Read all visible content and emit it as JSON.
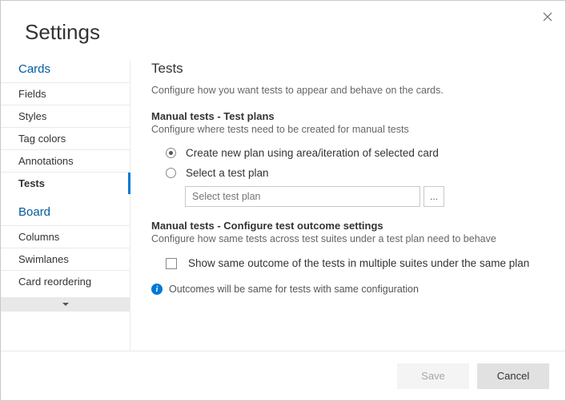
{
  "header": {
    "title": "Settings"
  },
  "sidebar": {
    "sections": [
      {
        "heading": "Cards",
        "items": [
          {
            "label": "Fields",
            "selected": false
          },
          {
            "label": "Styles",
            "selected": false
          },
          {
            "label": "Tag colors",
            "selected": false
          },
          {
            "label": "Annotations",
            "selected": false
          },
          {
            "label": "Tests",
            "selected": true
          }
        ]
      },
      {
        "heading": "Board",
        "items": [
          {
            "label": "Columns",
            "selected": false
          },
          {
            "label": "Swimlanes",
            "selected": false
          },
          {
            "label": "Card reordering",
            "selected": false
          }
        ]
      }
    ]
  },
  "content": {
    "title": "Tests",
    "subtitle": "Configure how you want tests to appear and behave on the cards.",
    "group1": {
      "title": "Manual tests - Test plans",
      "sub": "Configure where tests need to be created for manual tests",
      "optionA": "Create new plan using area/iteration of selected card",
      "optionB": "Select a test plan",
      "plan_placeholder": "Select test plan",
      "browse_label": "..."
    },
    "group2": {
      "title": "Manual tests - Configure test outcome settings",
      "sub": "Configure how same tests across test suites under a test plan need to behave",
      "checkbox_label": "Show same outcome of the tests in multiple suites under the same plan"
    },
    "info": "Outcomes will be same for tests with same configuration"
  },
  "footer": {
    "save": "Save",
    "cancel": "Cancel"
  }
}
